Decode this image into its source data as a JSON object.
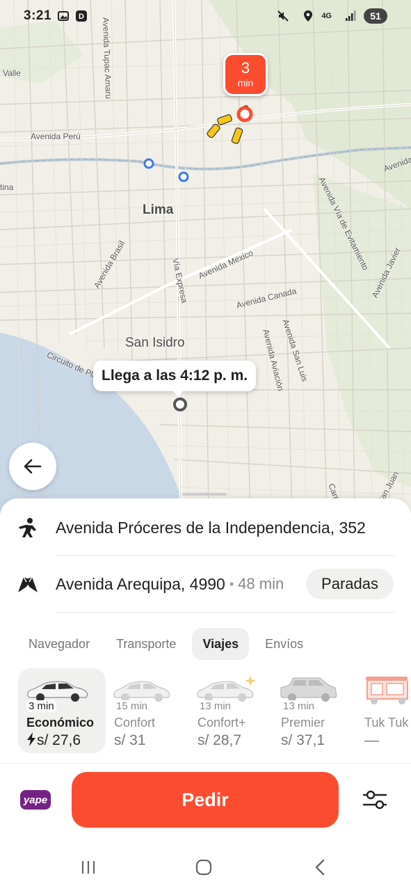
{
  "status_bar": {
    "time": "3:21",
    "network": "4G",
    "battery": "51",
    "icons": [
      "gallery-icon",
      "d-app-icon",
      "mute-icon",
      "location-icon",
      "signal-icon"
    ]
  },
  "map": {
    "city_label": "Lima",
    "district_label": "San Isidro",
    "street_labels": [
      "Avenida Perú",
      "Avenida Tupac Amaru",
      "Valle",
      "Avenida Brasil",
      "Vía Expresa",
      "Avenida Mexico",
      "Avenida Canada",
      "Avenida Aviación",
      "Avenida San Luis",
      "Avenida Vía de Evitamiento",
      "Avenida Javier",
      "Circuito de Playas",
      "Carretera",
      "San Juan",
      "tina",
      "Avenida"
    ],
    "eta_badge": {
      "value": "3",
      "unit": "min"
    },
    "arrival_tooltip": "Llega a las 4:12 p. m."
  },
  "route": {
    "origin": "Avenida Próceres de la Independencia, 352",
    "destination": "Avenida Arequipa, 4990",
    "destination_time": "48 min",
    "stops_button": "Paradas"
  },
  "tabs": [
    {
      "label": "Navegador",
      "active": false
    },
    {
      "label": "Transporte",
      "active": false
    },
    {
      "label": "Viajes",
      "active": true
    },
    {
      "label": "Envíos",
      "active": false
    }
  ],
  "tariffs": [
    {
      "eta": "3 min",
      "name": "Económico",
      "price": "s/ 27,6",
      "active": true
    },
    {
      "eta": "15 min",
      "name": "Confort",
      "price": "s/ 31",
      "active": false
    },
    {
      "eta": "13 min",
      "name": "Confort+",
      "price": "s/ 28,7",
      "active": false
    },
    {
      "eta": "13 min",
      "name": "Premier",
      "price": "s/ 37,1",
      "active": false
    },
    {
      "eta": "",
      "name": "Tuk Tuk",
      "price": "—",
      "active": false
    }
  ],
  "action": {
    "payment_label": "yape",
    "order_button": "Pedir"
  },
  "colors": {
    "accent": "#fc4c2f",
    "yape": "#742284",
    "map_bg": "#f1efe7",
    "sea": "#c8d8e8",
    "park": "#dfe8d2"
  }
}
